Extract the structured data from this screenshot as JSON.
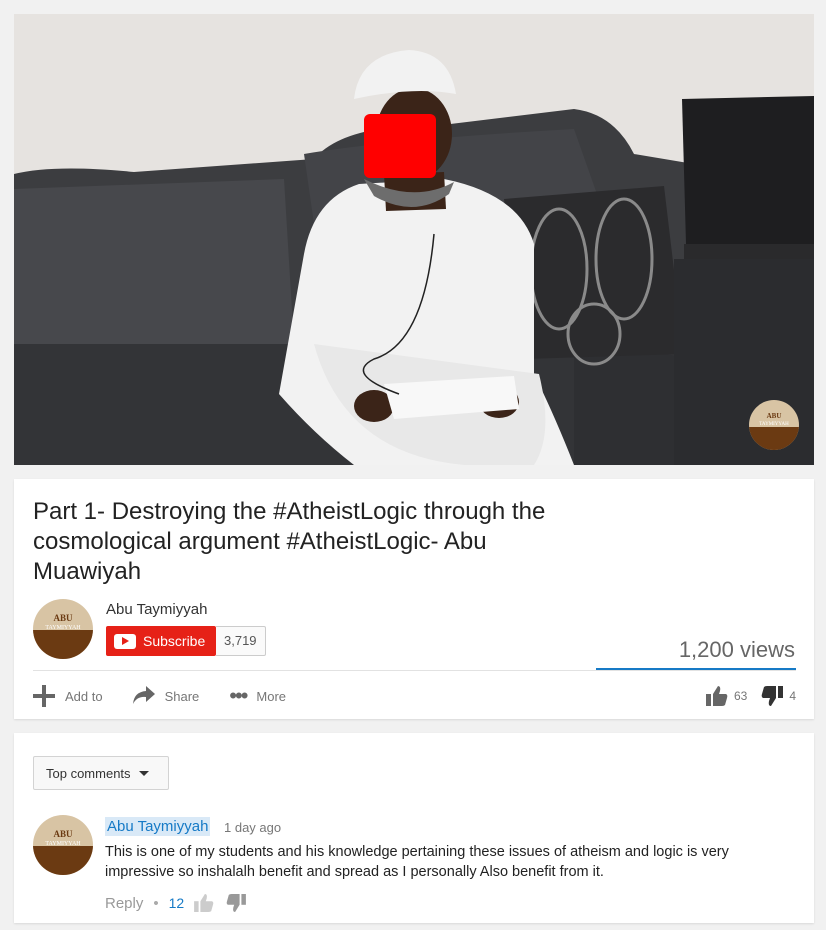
{
  "video": {
    "title": "Part 1- Destroying the #AtheistLogic through the cosmological argument #AtheistLogic- Abu Muawiyah",
    "watermark": {
      "line1": "ABU",
      "line2": "TAYMIYYAH"
    }
  },
  "channel": {
    "name": "Abu Taymiyyah",
    "avatar": {
      "line1": "ABU",
      "line2": "TAYMIYYAH"
    },
    "subscribe_label": "Subscribe",
    "subscriber_count": "3,719"
  },
  "stats": {
    "views": "1,200 views",
    "likes": "63",
    "dislikes": "4"
  },
  "actions": {
    "add_to": "Add to",
    "share": "Share",
    "more": "More"
  },
  "comments": {
    "sort_label": "Top comments",
    "items": [
      {
        "author": "Abu Taymiyyah",
        "time": "1 day ago",
        "text": "This is one of my students and his knowledge pertaining these issues of atheism and logic is very impressive so inshalalh benefit and spread as I personally Also benefit from it.",
        "reply_label": "Reply",
        "likes": "12"
      }
    ]
  },
  "colors": {
    "accent_blue": "#167ac6",
    "subscribe_red": "#e62117",
    "avatar_brown": "#6b3a12",
    "avatar_tan": "#d8c4a4"
  },
  "icons": [
    "plus-icon",
    "share-icon",
    "more-dots-icon",
    "thumbs-up-icon",
    "thumbs-down-icon",
    "caret-down-icon",
    "youtube-icon"
  ]
}
